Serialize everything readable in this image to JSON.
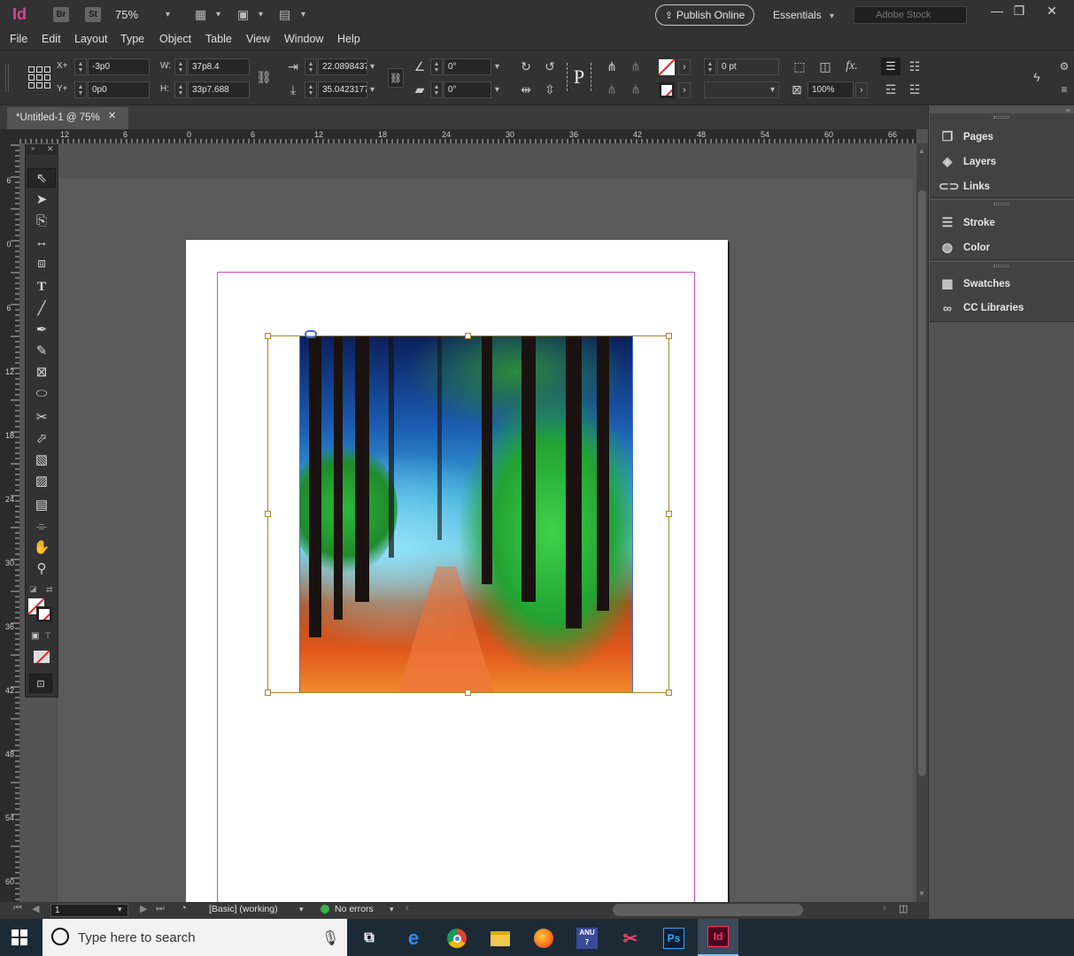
{
  "titlebar": {
    "app_icon": "Id",
    "bridge": "Br",
    "stock": "St",
    "zoom": "75%",
    "publish_label": "Publish Online",
    "workspace": "Essentials",
    "stock_placeholder": "Adobe Stock"
  },
  "menu": [
    "File",
    "Edit",
    "Layout",
    "Type",
    "Object",
    "Table",
    "View",
    "Window",
    "Help"
  ],
  "control": {
    "x_label": "X+",
    "x_value": "-3p0",
    "y_label": "Y+",
    "y_value": "0p0",
    "w_label": "W:",
    "w_value": "37p8.4",
    "h_label": "H:",
    "h_value": "33p7.688",
    "scale_x": "22.0898437",
    "scale_y": "35.0423177",
    "rotate": "0°",
    "shear": "0°",
    "stroke_weight": "0 pt",
    "opacity": "100%",
    "type_on_path": "P",
    "fx": "fx."
  },
  "document": {
    "tab_title": "*Untitled-1 @ 75%",
    "close": "✕"
  },
  "ruler": {
    "horizontal": [
      "12",
      "6",
      "0",
      "6",
      "12",
      "18",
      "24",
      "30",
      "36",
      "42",
      "48",
      "54",
      "60",
      "66"
    ],
    "vertical": [
      "6",
      "0",
      "6",
      "12",
      "18",
      "24",
      "30",
      "36",
      "42",
      "48",
      "54",
      "60"
    ]
  },
  "status": {
    "page": "1",
    "preflight_profile": "[Basic] (working)",
    "errors": "No errors"
  },
  "panels": {
    "group1": [
      "Pages",
      "Layers",
      "Links"
    ],
    "group2": [
      "Stroke",
      "Color"
    ],
    "group3": [
      "Swatches",
      "CC Libraries"
    ]
  },
  "taskbar": {
    "search_placeholder": "Type here to search",
    "ps": "Ps",
    "id": "Id",
    "anu": "ANU"
  },
  "colors": {
    "indesign_pink": "#d5478c",
    "frame_gold": "#a8852a",
    "margin_magenta": "#c54fc4",
    "none_red": "#e0242d"
  }
}
